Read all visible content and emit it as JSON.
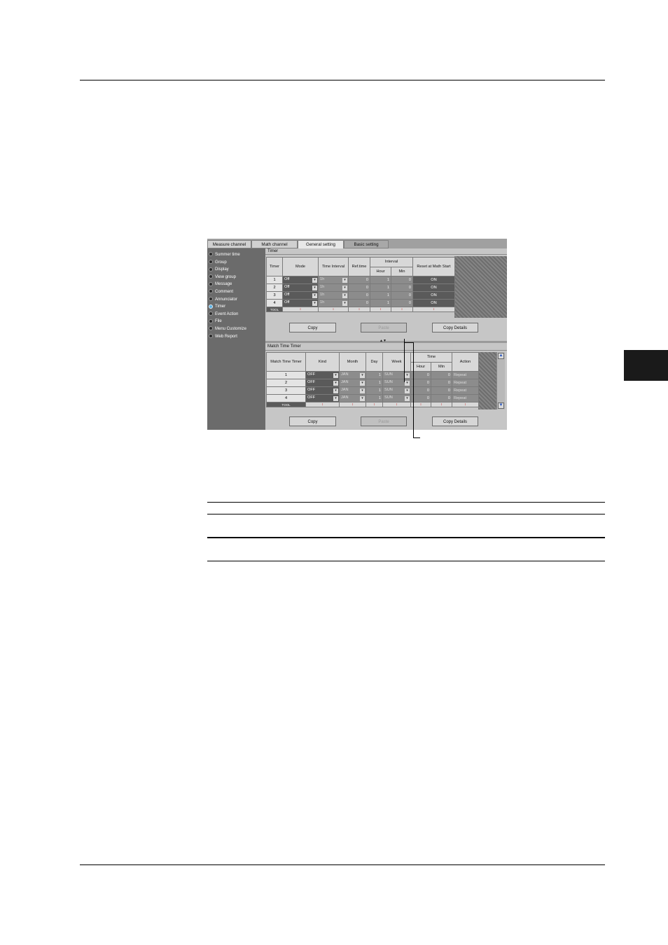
{
  "tabs": [
    "Measure channel",
    "Math channel",
    "General setting",
    "Basic setting"
  ],
  "sidebar": {
    "items": [
      "Summer time",
      "Group",
      "Display",
      "View group",
      "Message",
      "Comment",
      "Annunciator",
      "Timer",
      "Event Action",
      "File",
      "Menu Customize",
      "Web Report"
    ],
    "selected": "Timer"
  },
  "timer": {
    "title": "Timer",
    "headers": {
      "timer": "Timer",
      "mode": "Mode",
      "time_interval": "Time Interval",
      "ref_time": "Ref.time",
      "interval": "Interval",
      "hour": "Hour",
      "min": "Min",
      "reset": "Reset at Math Start"
    },
    "rows": [
      {
        "no": "1",
        "mode": "Off",
        "time_interval": "1h",
        "ref_time": "0",
        "hour": "1",
        "min": "0",
        "reset": "ON"
      },
      {
        "no": "2",
        "mode": "Off",
        "time_interval": "1h",
        "ref_time": "0",
        "hour": "1",
        "min": "0",
        "reset": "ON"
      },
      {
        "no": "3",
        "mode": "Off",
        "time_interval": "1h",
        "ref_time": "0",
        "hour": "1",
        "min": "0",
        "reset": "ON"
      },
      {
        "no": "4",
        "mode": "Off",
        "time_interval": "1h",
        "ref_time": "0",
        "hour": "1",
        "min": "0",
        "reset": "ON"
      }
    ],
    "total_label": "TOOL"
  },
  "buttons": {
    "copy": "Copy",
    "paste": "Paste",
    "copy_details": "Copy Details"
  },
  "match_timer": {
    "title": "Match Time Timer",
    "headers": {
      "match_time_timer": "Match Time Timer",
      "kind": "Kind",
      "month": "Month",
      "day": "Day",
      "week": "Week",
      "time": "Time",
      "hour": "Hour",
      "min": "Min",
      "action": "Action"
    },
    "rows": [
      {
        "no": "1",
        "kind": "OFF",
        "month": "JAN",
        "day": "1",
        "week": "SUN",
        "hour": "0",
        "min": "0",
        "action": "Repeat"
      },
      {
        "no": "2",
        "kind": "OFF",
        "month": "JAN",
        "day": "1",
        "week": "SUN",
        "hour": "0",
        "min": "0",
        "action": "Repeat"
      },
      {
        "no": "3",
        "kind": "OFF",
        "month": "JAN",
        "day": "1",
        "week": "SUN",
        "hour": "0",
        "min": "0",
        "action": "Repeat"
      },
      {
        "no": "4",
        "kind": "OFF",
        "month": "JAN",
        "day": "1",
        "week": "SUN",
        "hour": "0",
        "min": "0",
        "action": "Repeat"
      }
    ],
    "total_label": "TOOL"
  },
  "icons": {
    "dropdown": "▾",
    "total_marker": "↕",
    "scroll_up": "▲",
    "scroll_down": "▼",
    "splitter": "▲▼"
  }
}
